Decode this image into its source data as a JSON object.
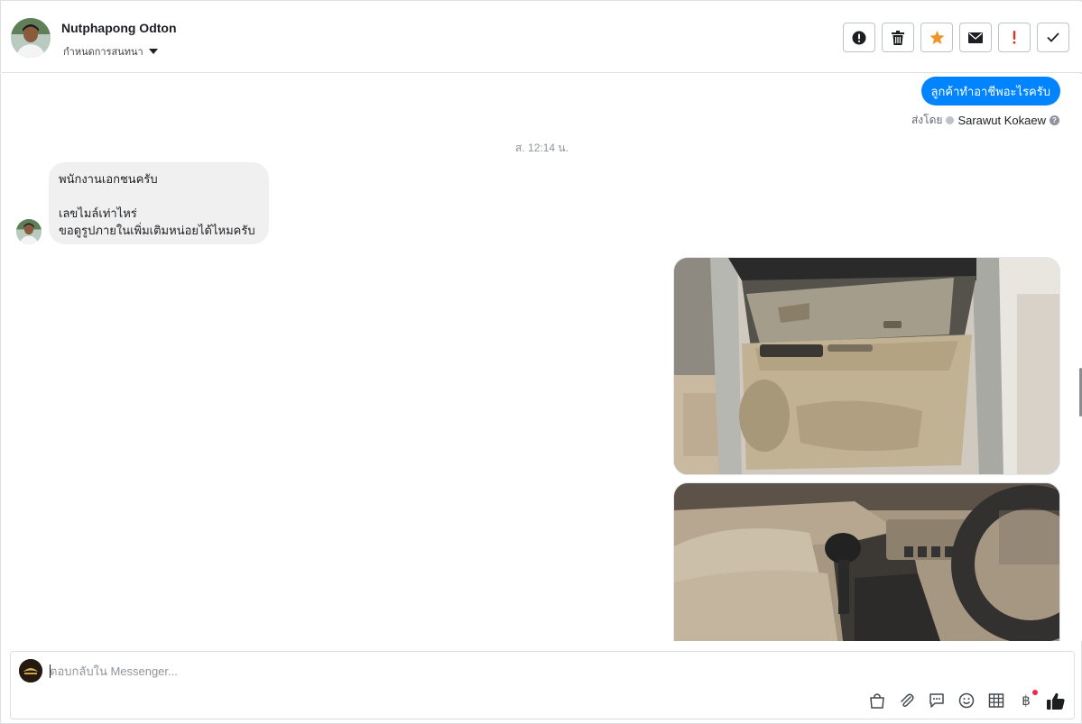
{
  "header": {
    "contact_name": "Nutphapong Odton",
    "conversation_status": "กำหนดการสนทนา"
  },
  "toolbar": {
    "buttons": [
      {
        "name": "spam",
        "icon": "exclamation-circle-icon"
      },
      {
        "name": "delete",
        "icon": "trash-icon"
      },
      {
        "name": "star",
        "icon": "star-icon",
        "color": "#f0932b"
      },
      {
        "name": "mark-unread",
        "icon": "envelope-icon"
      },
      {
        "name": "follow-up",
        "icon": "exclamation-icon",
        "color": "#e0321c"
      },
      {
        "name": "mark-done",
        "icon": "checkmark-icon"
      }
    ]
  },
  "thread": {
    "outgoing_message": "ลูกค้าทำอาชีพอะไรครับ",
    "sent_by_prefix": "ส่งโดย",
    "sent_by_agent": "Sarawut Kokaew",
    "timestamp": "ส. 12:14 น.",
    "incoming_message": {
      "line1": "พนักงานเอกชนครับ",
      "line2": "เลขไมล์เท่าไหร่",
      "line3": "ขอดูรูปภายในเพิ่มเติมหน่อยได้ไหมครับ"
    },
    "photos": [
      {
        "name": "car-door-interior-photo"
      },
      {
        "name": "car-seat-gearshift-photo"
      }
    ]
  },
  "composer": {
    "placeholder": "ตอบกลับใน Messenger...",
    "tools": [
      "shop-bag-icon",
      "paperclip-icon",
      "chat-bubble-icon",
      "emoji-icon",
      "table-icon",
      "baht-icon",
      "thumbs-up-icon"
    ],
    "baht_symbol": "฿",
    "accent": "#0084ff"
  }
}
